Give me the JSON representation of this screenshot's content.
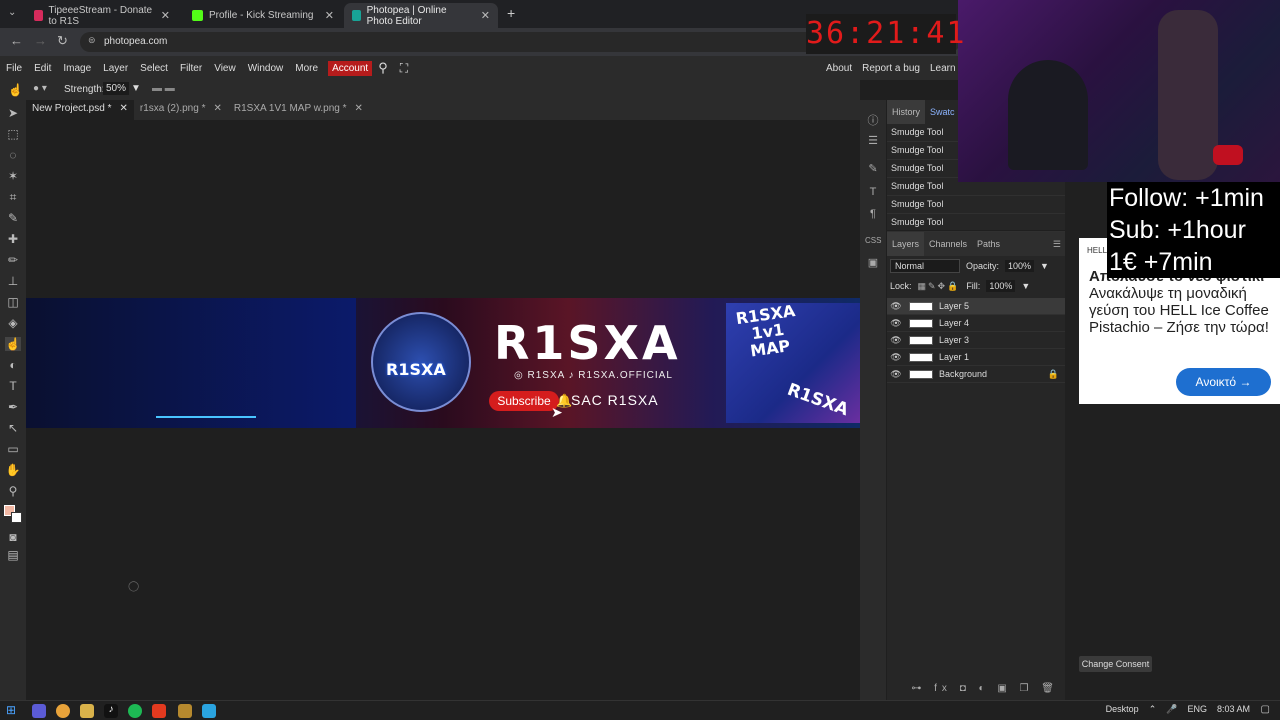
{
  "browser": {
    "tabs": [
      {
        "title": "TipeeeStream - Donate to R1S",
        "color": "#d62b5c"
      },
      {
        "title": "Profile - Kick Streaming",
        "color": "#53fc18"
      },
      {
        "title": "Photopea | Online Photo Editor",
        "color": "#18a497"
      }
    ],
    "new_tab": "+",
    "url": "photopea.com"
  },
  "menu": {
    "items": [
      "File",
      "Edit",
      "Image",
      "Layer",
      "Select",
      "Filter",
      "View",
      "Window",
      "More"
    ],
    "account": "Account",
    "right_links": [
      "About",
      "Report a bug",
      "Learn"
    ]
  },
  "options": {
    "strength_label": "Strength:",
    "strength_value": "50%"
  },
  "doc_tabs": [
    {
      "title": "New Project.psd *",
      "active": true
    },
    {
      "title": "r1sxa (2).png *",
      "active": false
    },
    {
      "title": "R1SXA 1V1 MAP w.png *",
      "active": false
    }
  ],
  "banner": {
    "title": "R1SXA",
    "avatar_name": "R1SXA",
    "socials": "◎ R1SXA  ♪ R1SXA.OFFICIAL",
    "subscribe": "Subscribe",
    "sac": "SAC R1SXA",
    "map_text": [
      "R1SXA",
      "1v1",
      "MAP"
    ],
    "corner_text": "R1SXA"
  },
  "history": {
    "tabs": [
      "History",
      "Swatc"
    ],
    "items": [
      "Smudge Tool",
      "Smudge Tool",
      "Smudge Tool",
      "Smudge Tool",
      "Smudge Tool",
      "Smudge Tool"
    ]
  },
  "layers": {
    "tabs": [
      "Layers",
      "Channels",
      "Paths"
    ],
    "blend_mode": "Normal",
    "opacity_label": "Opacity:",
    "opacity_value": "100%",
    "lock_label": "Lock:",
    "fill_label": "Fill:",
    "fill_value": "100%",
    "items": [
      "Layer 5",
      "Layer 4",
      "Layer 3",
      "Layer 1",
      "Background"
    ]
  },
  "overlay": {
    "timer": "36:21:41",
    "follow_lines": [
      "Follow: +1min",
      "Sub: +1hour",
      "1€ +7min"
    ]
  },
  "ad": {
    "brand": "HELL",
    "text_bold": "Απολαύσε το νέο φιστίκι",
    "text_rest": "Ανακάλυψε τη μοναδική γεύση του HELL Ice Coffee Pistachio – Ζήσε την τώρα!",
    "button": "Ανοικτό",
    "consent": "Change Consent"
  },
  "taskbar": {
    "desktop": "Desktop",
    "lang": "ENG",
    "time": "8:03 AM"
  }
}
